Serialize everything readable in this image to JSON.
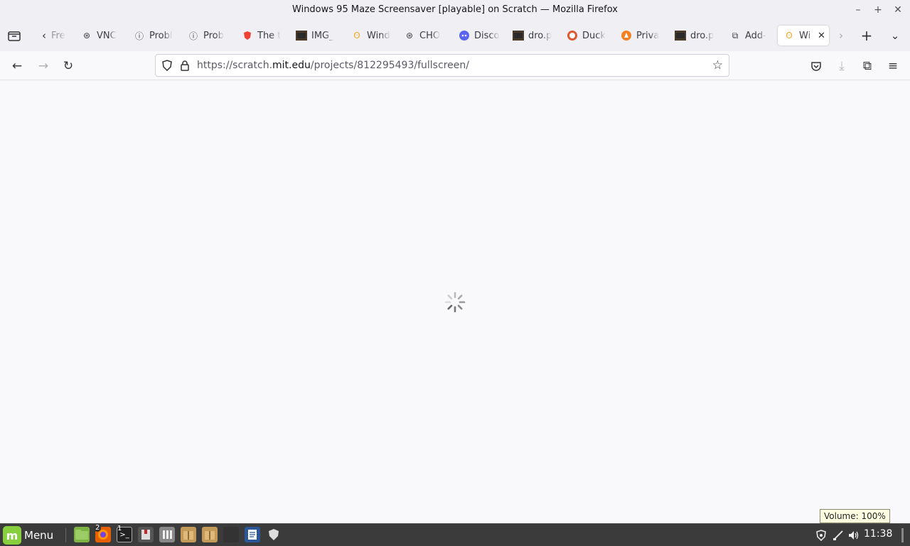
{
  "window": {
    "title": "Windows 95 Maze Screensaver [playable] on Scratch — Mozilla Firefox",
    "minimize_icon": "minimize-icon",
    "maximize_icon": "maximize-icon",
    "close_icon": "close-icon"
  },
  "tabs": [
    {
      "label": "Fre",
      "icon": "generic-icon"
    },
    {
      "label": "VNC",
      "icon": "github-icon"
    },
    {
      "label": "Probl",
      "icon": "info-icon"
    },
    {
      "label": "Prob",
      "icon": "info-icon"
    },
    {
      "label": "The t",
      "icon": "brave-shield-icon"
    },
    {
      "label": "IMG_",
      "icon": "image-icon"
    },
    {
      "label": "Wind",
      "icon": "scratch-icon"
    },
    {
      "label": "CHO",
      "icon": "github-icon"
    },
    {
      "label": "Disco",
      "icon": "discord-icon"
    },
    {
      "label": "dro.p",
      "icon": "image-icon"
    },
    {
      "label": "Duck",
      "icon": "duckduckgo-icon"
    },
    {
      "label": "Priva",
      "icon": "privacy-icon"
    },
    {
      "label": "dro.p",
      "icon": "image-icon"
    },
    {
      "label": "Add-",
      "icon": "puzzle-icon"
    },
    {
      "label": "Wi",
      "icon": "scratch-icon",
      "active": true
    }
  ],
  "navbar": {
    "url_prefix": "https://scratch.",
    "url_domain": "mit.edu",
    "url_path": "/projects/812295493/fullscreen/"
  },
  "taskbar": {
    "menu_label": "Menu",
    "firefox_badge": "2",
    "terminal_badge": "1",
    "clock": "11:38",
    "volume_tooltip": "Volume: 100%"
  },
  "colors": {
    "accent": "#87cf3e",
    "taskbar": "#3b3b3b",
    "page_bg": "#f9f9fb"
  }
}
